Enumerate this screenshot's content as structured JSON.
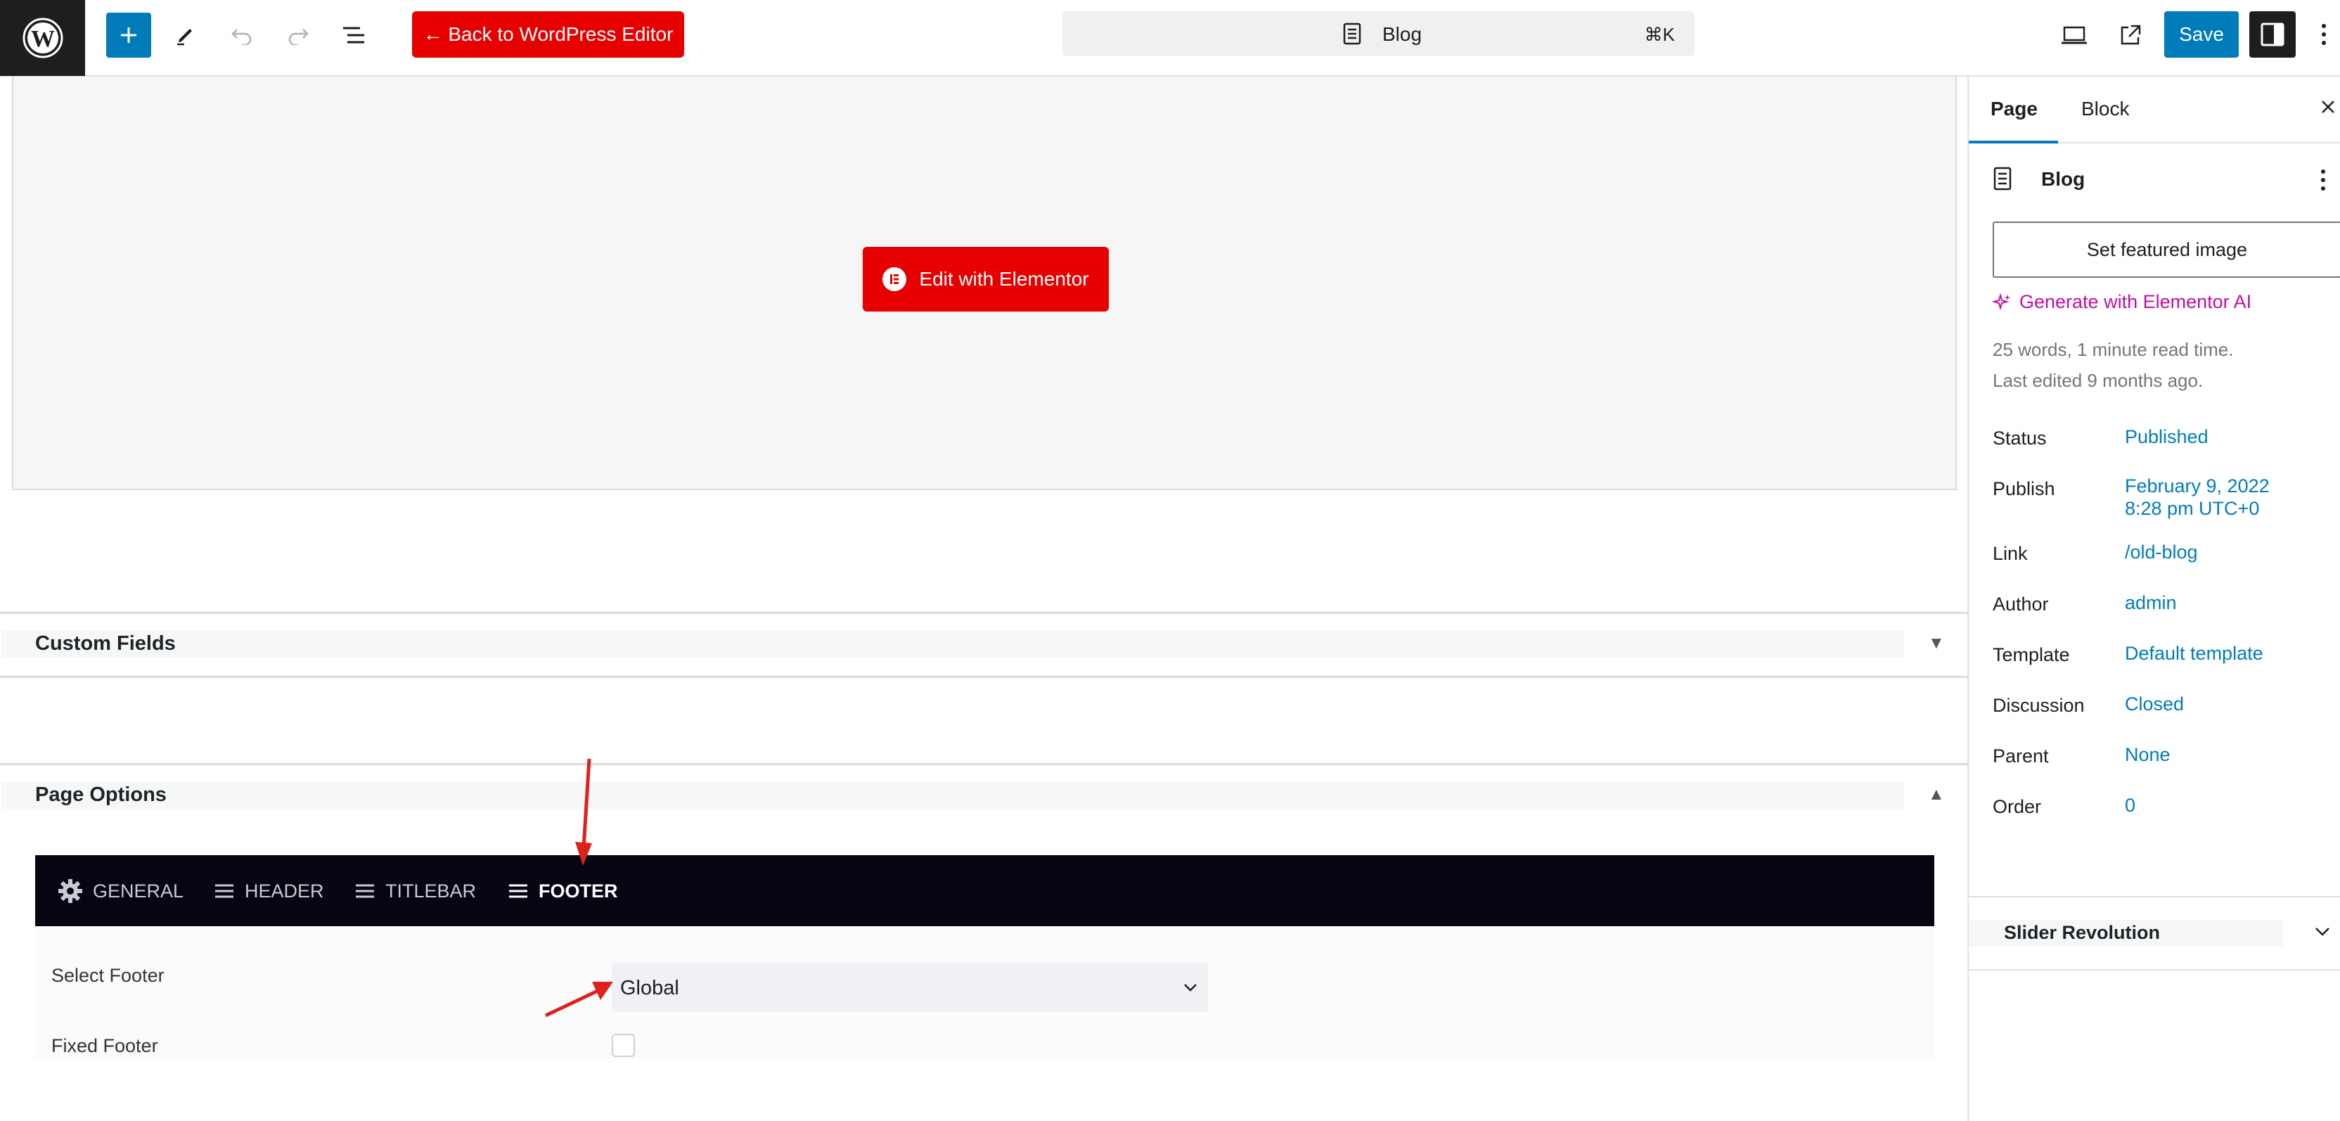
{
  "topbar": {
    "back_label": "← Back to WordPress Editor",
    "document_title": "Blog",
    "command_shortcut": "⌘K",
    "save_label": "Save"
  },
  "canvas": {
    "elementor_button": "Edit with Elementor"
  },
  "metaboxes": {
    "custom_fields_title": "Custom Fields",
    "page_options_title": "Page Options"
  },
  "page_options": {
    "tabs": [
      {
        "label": "GENERAL",
        "icon": "gear-icon"
      },
      {
        "label": "HEADER",
        "icon": "menu-lines-icon"
      },
      {
        "label": "TITLEBAR",
        "icon": "menu-lines-icon"
      },
      {
        "label": "FOOTER",
        "icon": "menu-lines-icon",
        "active": true
      }
    ],
    "select_footer_label": "Select Footer",
    "select_footer_value": "Global",
    "fixed_footer_label": "Fixed Footer",
    "fixed_footer_checked": false
  },
  "sidebar": {
    "tabs": [
      "Page",
      "Block"
    ],
    "active_tab": "Page",
    "document_title": "Blog",
    "featured_image_button": "Set featured image",
    "ai_link": "Generate with Elementor AI",
    "word_count": "25 words, 1 minute read time.",
    "last_edited": "Last edited 9 months ago.",
    "properties": [
      {
        "label": "Status",
        "value": "Published"
      },
      {
        "label": "Publish",
        "value": "February 9, 2022",
        "value2": "8:28 pm UTC+0"
      },
      {
        "label": "Link",
        "value": "/old-blog"
      },
      {
        "label": "Author",
        "value": "admin"
      },
      {
        "label": "Template",
        "value": "Default template"
      },
      {
        "label": "Discussion",
        "value": "Closed"
      },
      {
        "label": "Parent",
        "value": "None"
      },
      {
        "label": "Order",
        "value": "0"
      }
    ],
    "slider_revolution_title": "Slider Revolution"
  },
  "colors": {
    "wp_blue": "#007cba",
    "elementor_red": "#e60000",
    "ai_magenta": "#c20fa0",
    "options_bar": "#050612"
  }
}
